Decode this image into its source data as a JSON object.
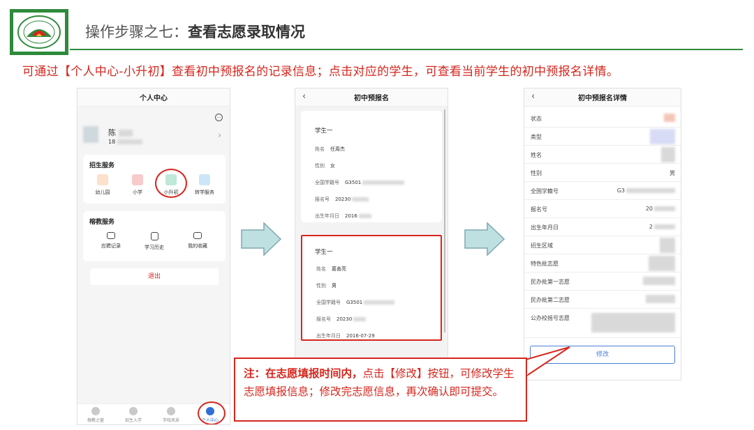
{
  "header": {
    "title_prefix": "操作步骤之七：",
    "title_main": "查看志愿录取情况",
    "intro": "可通过【个人中心-小升初】查看初中预报名的记录信息；点击对应的学生，可查看当前学生的初中预报名详情。"
  },
  "colors": {
    "accent_green": "#2f8a3c",
    "accent_red": "#d6261d",
    "arrow_fill": "#bfe0e0"
  },
  "panel1": {
    "title": "个人中心",
    "user_name": "陈",
    "user_phone": "18",
    "enroll_section": "招生服务",
    "enroll_items": [
      "幼儿园",
      "小学",
      "小升初",
      "转学服务"
    ],
    "edu_section": "榕教服务",
    "edu_items": [
      "应聘记录",
      "学习历史",
      "我的收藏"
    ],
    "logout": "退出",
    "tabs": [
      "榕教之窗",
      "招生入学",
      "学校风采",
      "个人中心"
    ]
  },
  "panel2": {
    "title": "初中预报名",
    "cards": [
      {
        "student": "学生一",
        "name_label": "姓名",
        "name": "任周杰",
        "gender_label": "性别",
        "gender": "女",
        "id_label": "全国学籍号",
        "id": "G3501",
        "reg_label": "报名号",
        "reg": "20230",
        "dob_label": "出生年月日",
        "dob": "2016"
      },
      {
        "student": "学生一",
        "name_label": "姓名",
        "name": "葛善亮",
        "gender_label": "性别",
        "gender": "男",
        "id_label": "全国学籍号",
        "id": "G3501",
        "reg_label": "报名号",
        "reg": "20230",
        "dob_label": "出生年月日",
        "dob": "2016-07-29"
      }
    ]
  },
  "panel3": {
    "title": "初中预报名详情",
    "rows": [
      {
        "label": "状态",
        "value": ""
      },
      {
        "label": "类型",
        "value": ""
      },
      {
        "label": "姓名",
        "value": ""
      },
      {
        "label": "性别",
        "value": "男"
      },
      {
        "label": "全国学籍号",
        "value": "G3"
      },
      {
        "label": "报名号",
        "value": "20"
      },
      {
        "label": "出生年月日",
        "value": "2"
      },
      {
        "label": "招生区域",
        "value": ""
      },
      {
        "label": "特色批志愿",
        "value": ""
      },
      {
        "label": "民办批第一志愿",
        "value": ""
      },
      {
        "label": "民办批第二志愿",
        "value": ""
      },
      {
        "label": "公办校摇号志愿",
        "value": ""
      }
    ],
    "modify_button": "修改"
  },
  "note": {
    "bold": "注：在志愿填报时间内，",
    "text": "点击【修改】按钮，可修改学生志愿填报信息；修改完志愿信息，再次确认即可提交。"
  }
}
